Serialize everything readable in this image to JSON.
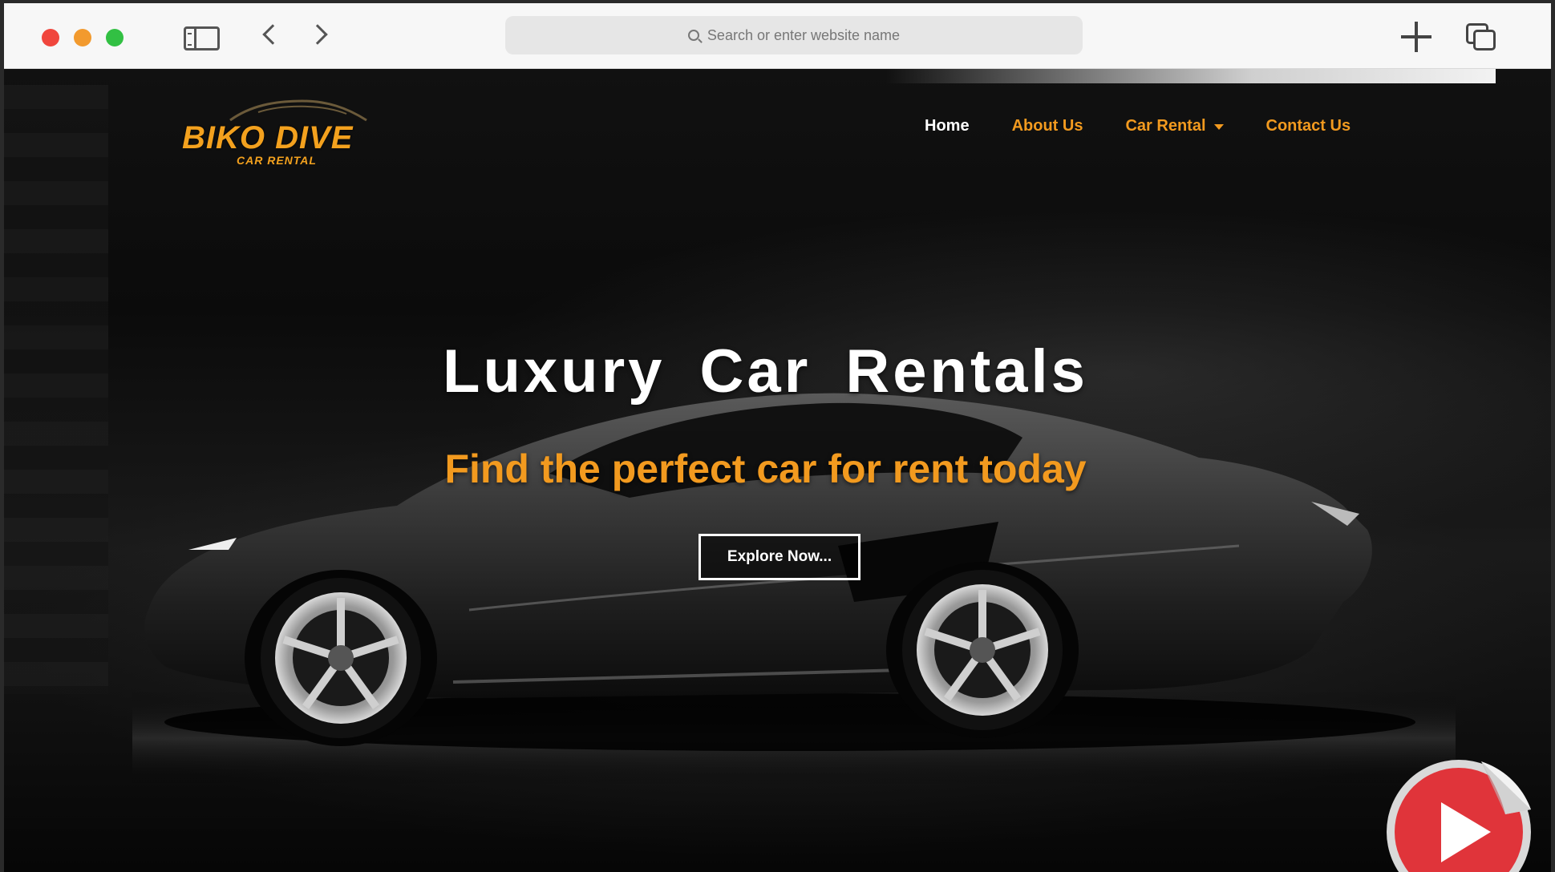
{
  "browser": {
    "url_placeholder": "Search or enter website name"
  },
  "site": {
    "brand_name": "BIKO DIVE",
    "brand_tagline": "CAR RENTAL",
    "nav": [
      {
        "label": "Home",
        "active": true
      },
      {
        "label": "About Us",
        "active": false
      },
      {
        "label": "Car Rental",
        "active": false,
        "dropdown": true
      },
      {
        "label": "Contact Us",
        "active": false
      }
    ]
  },
  "hero": {
    "headline": "Luxury Car Rentals",
    "subheadline": "Find the perfect car for rent today",
    "cta_label": "Explore Now..."
  },
  "colors": {
    "accent": "#f29a1f",
    "play_red": "#e0343a"
  },
  "icons": [
    "sidebar-icon",
    "back-arrow-icon",
    "forward-arrow-icon",
    "search-icon",
    "plus-icon",
    "tabs-icon",
    "play-icon"
  ]
}
